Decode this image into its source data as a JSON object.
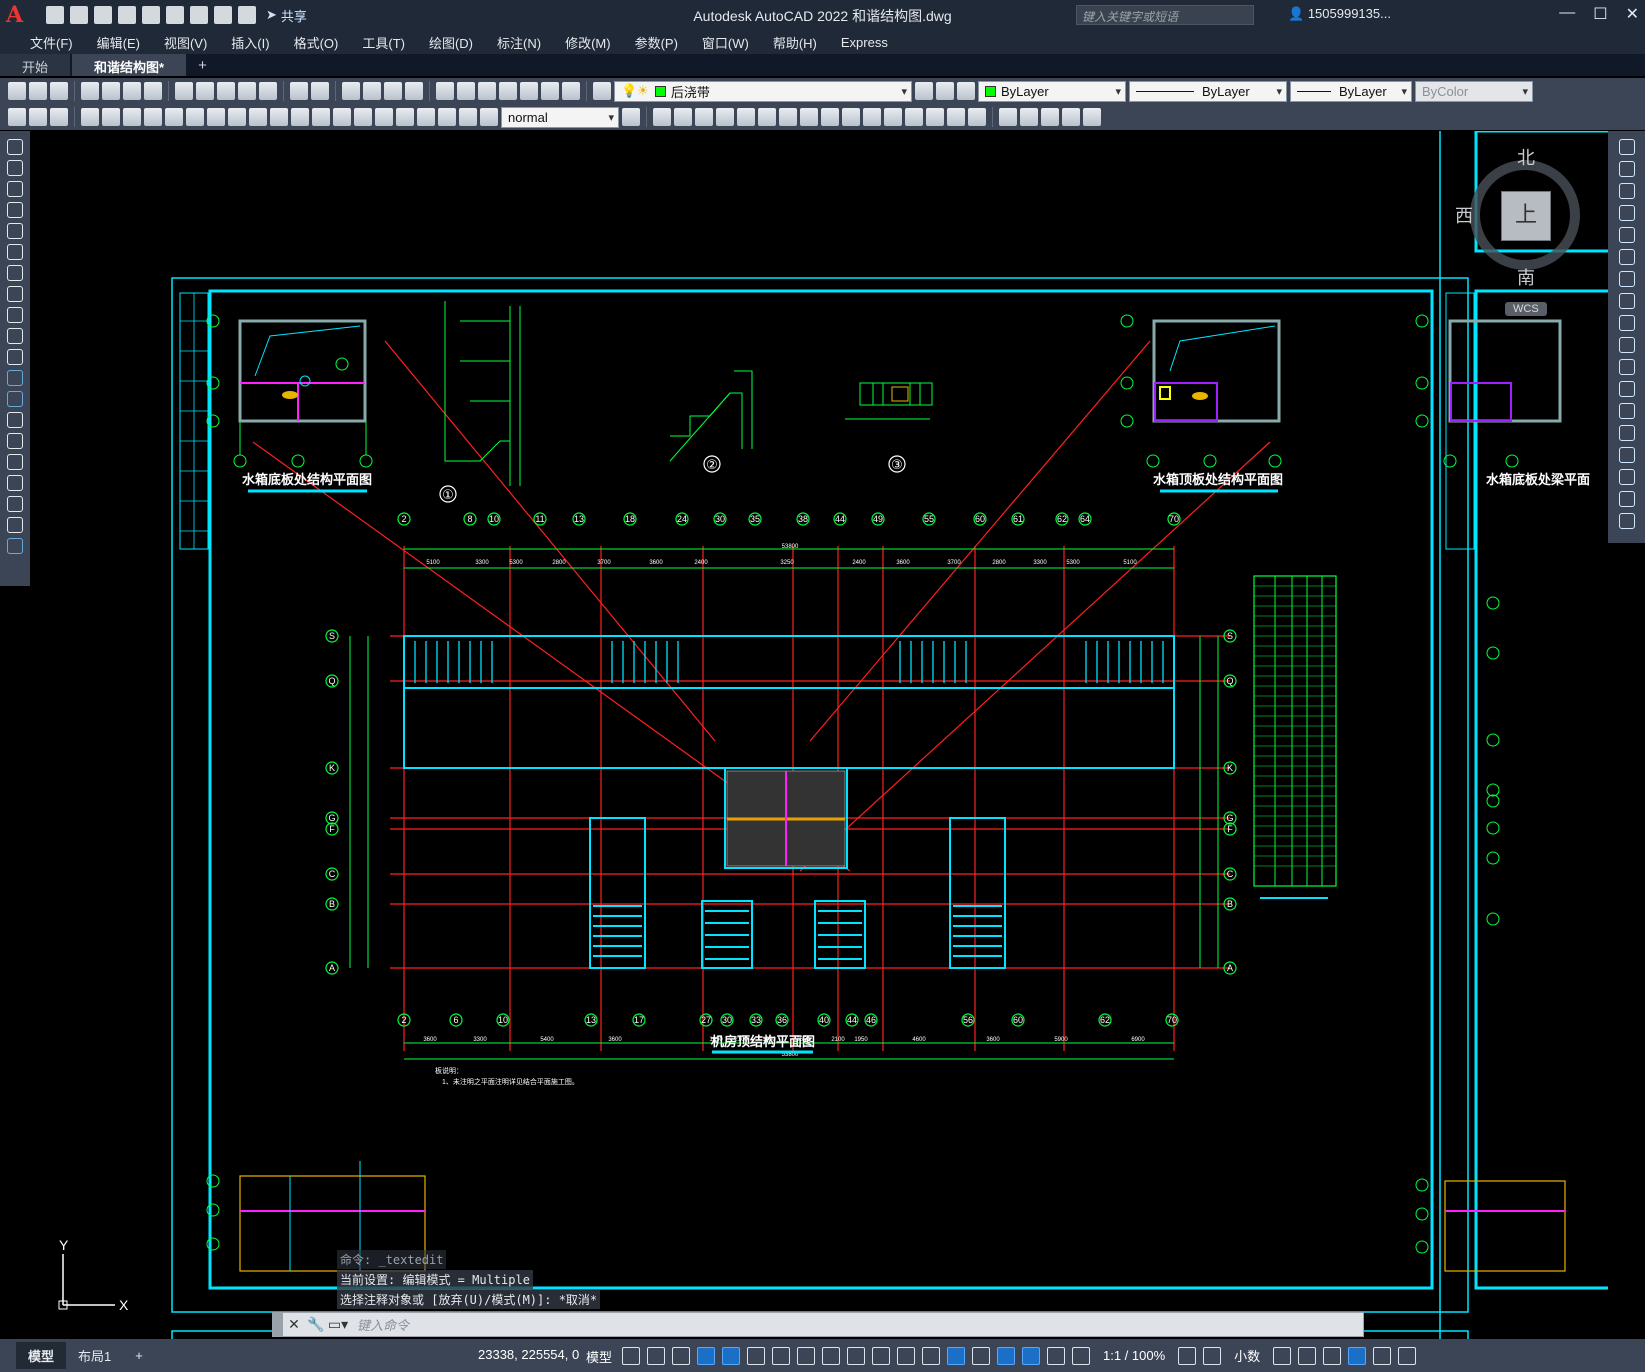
{
  "app": {
    "logo": "A",
    "title": "Autodesk AutoCAD 2022    和谐结构图.dwg",
    "share_label": "共享",
    "search_placeholder": "键入关键字或短语",
    "user": "1505999135...",
    "window_buttons": [
      "minimize-icon",
      "maximize-icon",
      "close-icon"
    ]
  },
  "menu": [
    "文件(F)",
    "编辑(E)",
    "视图(V)",
    "插入(I)",
    "格式(O)",
    "工具(T)",
    "绘图(D)",
    "标注(N)",
    "修改(M)",
    "参数(P)",
    "窗口(W)",
    "帮助(H)",
    "Express"
  ],
  "tabs": [
    {
      "label": "开始",
      "active": false
    },
    {
      "label": "和谐结构图*",
      "active": true
    }
  ],
  "toolbar": {
    "layer": "后浇带",
    "layer_color": "#00ff00",
    "color": "ByLayer",
    "linetype": "ByLayer",
    "lineweight": "ByLayer",
    "plotstyle": "ByColor",
    "dimstyle": "normal"
  },
  "viewcube": {
    "north": "北",
    "south": "南",
    "west": "西",
    "face": "上",
    "wcs": "WCS"
  },
  "drawing": {
    "title_main": "机房顶结构平面图",
    "title_left": "水箱底板处结构平面图",
    "title_right": "水箱顶板处结构平面图",
    "title_far_right": "水箱底板处梁平面",
    "detail_labels": [
      "①",
      "②",
      "③"
    ],
    "note_header": "板说明：",
    "note_text": "1、未注明之平面注明详见结合平面施工图。",
    "top_axes": [
      "2",
      "8",
      "10",
      "11",
      "13",
      "18",
      "24",
      "30",
      "35",
      "38",
      "44",
      "49",
      "55",
      "60",
      "61",
      "62",
      "64",
      "70"
    ],
    "bottom_axes": [
      "2",
      "6",
      "10",
      "13",
      "17",
      "27",
      "30",
      "33",
      "36",
      "40",
      "44",
      "46",
      "56",
      "60",
      "62",
      "70"
    ],
    "row_axes": [
      "S",
      "Q",
      "K",
      "G",
      "F",
      "C",
      "B",
      "A"
    ],
    "top_dims": [
      "5100",
      "3300",
      "5300",
      "2800",
      "3700",
      "3600",
      "2400",
      "3250",
      "2400",
      "3600",
      "3700",
      "2800",
      "3300",
      "5300",
      "5100"
    ],
    "bottom_dims": [
      "3600",
      "3300",
      "5400",
      "3600",
      "1950",
      "2100",
      "1950",
      "2650",
      "2100",
      "1950",
      "4600",
      "3600",
      "5900",
      "6900"
    ],
    "total_dim": "53800"
  },
  "command": {
    "history": [
      "命令: _textedit",
      "当前设置: 编辑模式 = Multiple",
      "选择注释对象或 [放弃(U)/模式(M)]: *取消*"
    ],
    "placeholder": "键入命令"
  },
  "status": {
    "layout_tabs": [
      "模型",
      "布局1"
    ],
    "coords": "23338, 225554, 0",
    "space": "模型",
    "scale": "1:1 / 100%",
    "units": "小数"
  }
}
